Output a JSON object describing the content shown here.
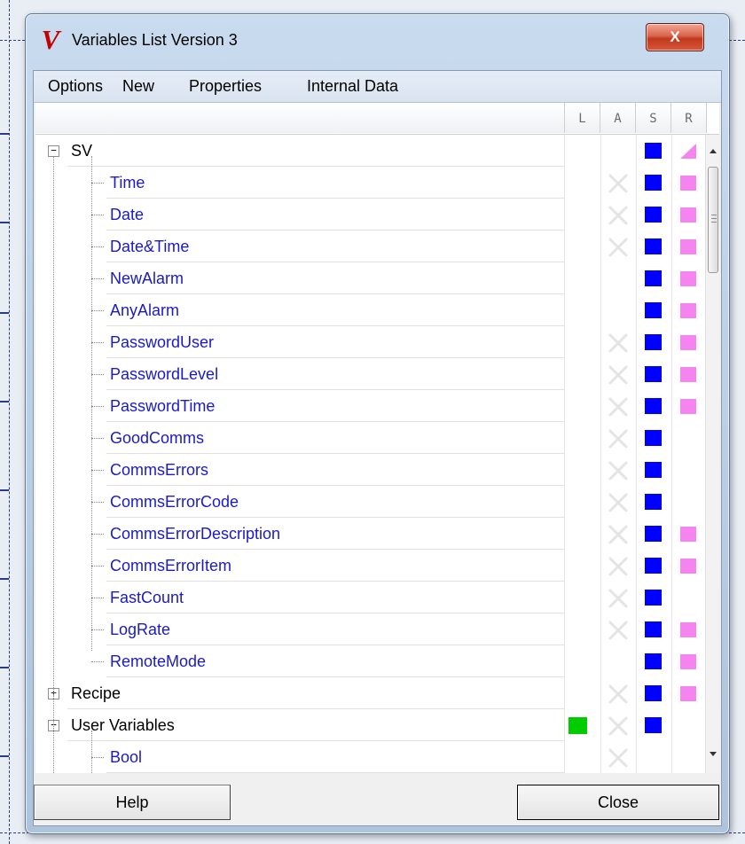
{
  "window": {
    "title": "Variables List Version 3",
    "logo": "V",
    "close_glyph": "X"
  },
  "menu": [
    "Options",
    "New",
    "Properties",
    "Internal Data"
  ],
  "columns": [
    "L",
    "A",
    "S",
    "R"
  ],
  "tree": [
    {
      "label": "SV",
      "level": 0,
      "expander": "−",
      "L": "",
      "A": "",
      "S": "blue",
      "R": "pink-triangle"
    },
    {
      "label": "Time",
      "level": 1,
      "L": "",
      "A": "x",
      "S": "blue",
      "R": "pink"
    },
    {
      "label": "Date",
      "level": 1,
      "L": "",
      "A": "x",
      "S": "blue",
      "R": "pink"
    },
    {
      "label": "Date&Time",
      "level": 1,
      "L": "",
      "A": "x",
      "S": "blue",
      "R": "pink"
    },
    {
      "label": "NewAlarm",
      "level": 1,
      "L": "",
      "A": "",
      "S": "blue",
      "R": "pink"
    },
    {
      "label": "AnyAlarm",
      "level": 1,
      "L": "",
      "A": "",
      "S": "blue",
      "R": "pink"
    },
    {
      "label": "PasswordUser",
      "level": 1,
      "L": "",
      "A": "x",
      "S": "blue",
      "R": "pink"
    },
    {
      "label": "PasswordLevel",
      "level": 1,
      "L": "",
      "A": "x",
      "S": "blue",
      "R": "pink"
    },
    {
      "label": "PasswordTime",
      "level": 1,
      "L": "",
      "A": "x",
      "S": "blue",
      "R": "pink"
    },
    {
      "label": "GoodComms",
      "level": 1,
      "L": "",
      "A": "x",
      "S": "blue",
      "R": ""
    },
    {
      "label": "CommsErrors",
      "level": 1,
      "L": "",
      "A": "x",
      "S": "blue",
      "R": ""
    },
    {
      "label": "CommsErrorCode",
      "level": 1,
      "L": "",
      "A": "x",
      "S": "blue",
      "R": ""
    },
    {
      "label": "CommsErrorDescription",
      "level": 1,
      "L": "",
      "A": "x",
      "S": "blue",
      "R": "pink"
    },
    {
      "label": "CommsErrorItem",
      "level": 1,
      "L": "",
      "A": "x",
      "S": "blue",
      "R": "pink"
    },
    {
      "label": "FastCount",
      "level": 1,
      "L": "",
      "A": "x",
      "S": "blue",
      "R": ""
    },
    {
      "label": "LogRate",
      "level": 1,
      "L": "",
      "A": "x",
      "S": "blue",
      "R": "pink"
    },
    {
      "label": "RemoteMode",
      "level": 1,
      "L": "",
      "A": "",
      "S": "blue",
      "R": "pink"
    },
    {
      "label": "Recipe",
      "level": 0,
      "expander": "+",
      "L": "",
      "A": "x",
      "S": "blue",
      "R": "pink"
    },
    {
      "label": "User Variables",
      "level": 0,
      "expander": "−",
      "L": "green",
      "A": "x",
      "S": "blue",
      "R": ""
    },
    {
      "label": "Bool",
      "level": 1,
      "L": "",
      "A": "x",
      "S": "",
      "R": ""
    }
  ],
  "buttons": {
    "help": "Help",
    "close": "Close"
  },
  "colors": {
    "link": "#1a1acc",
    "s_marker": "#0000ff",
    "r_marker": "#f584f0",
    "l_marker": "#00cc00"
  }
}
